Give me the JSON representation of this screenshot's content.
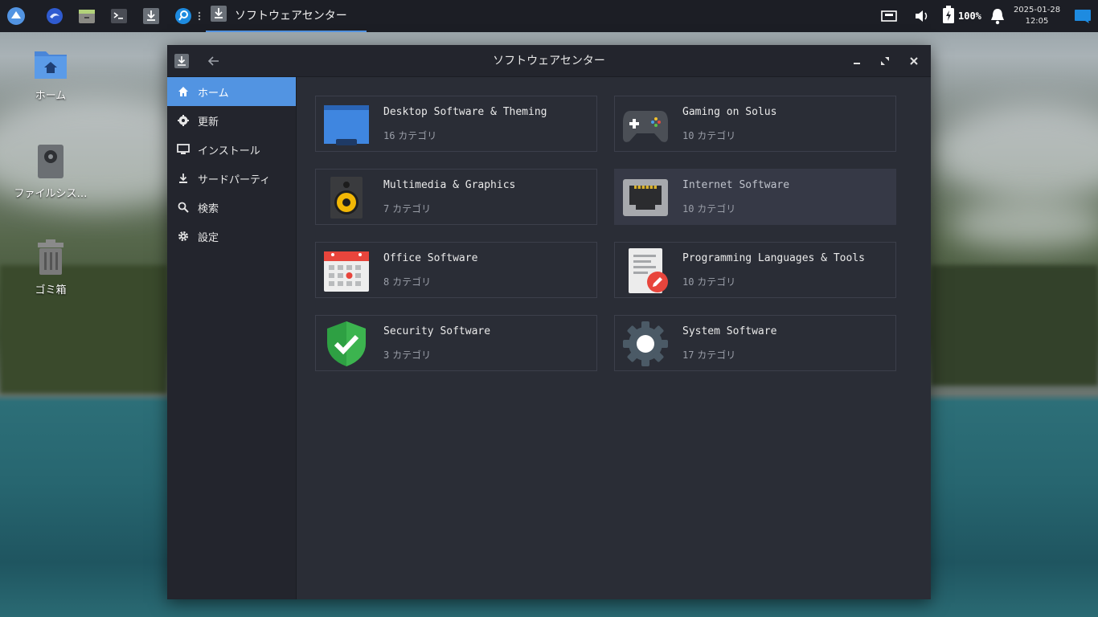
{
  "taskbar": {
    "active_task_label": "ソフトウェアセンター",
    "battery": "100%",
    "date": "2025-01-28",
    "time": "12:05"
  },
  "desktop": {
    "items": [
      {
        "label": "ホーム",
        "icon": "home-folder-icon"
      },
      {
        "label": "ファイルシス…",
        "icon": "drive-icon"
      },
      {
        "label": "ゴミ箱",
        "icon": "trash-icon"
      }
    ]
  },
  "window": {
    "title": "ソフトウェアセンター"
  },
  "sidebar": {
    "items": [
      {
        "label": "ホーム",
        "icon": "home-icon"
      },
      {
        "label": "更新",
        "icon": "update-gear-icon"
      },
      {
        "label": "インストール",
        "icon": "monitor-icon"
      },
      {
        "label": "サードパーティ",
        "icon": "download-icon"
      },
      {
        "label": "検索",
        "icon": "search-icon"
      },
      {
        "label": "設定",
        "icon": "settings-icon"
      }
    ]
  },
  "categories": [
    {
      "title": "Desktop Software & Theming",
      "count": "16",
      "suffix": "カテゴリ"
    },
    {
      "title": "Gaming on Solus",
      "count": "10",
      "suffix": "カテゴリ"
    },
    {
      "title": "Multimedia & Graphics",
      "count": "7",
      "suffix": "カテゴリ"
    },
    {
      "title": "Internet Software",
      "count": "10",
      "suffix": "カテゴリ"
    },
    {
      "title": "Office Software",
      "count": "8",
      "suffix": "カテゴリ"
    },
    {
      "title": "Programming Languages & Tools",
      "count": "10",
      "suffix": "カテゴリ"
    },
    {
      "title": "Security Software",
      "count": "3",
      "suffix": "カテゴリ"
    },
    {
      "title": "System Software",
      "count": "17",
      "suffix": "カテゴリ"
    }
  ],
  "colors": {
    "accent": "#5294e2",
    "window_bg": "#2a2d36",
    "sidebar_bg": "#23252d"
  }
}
